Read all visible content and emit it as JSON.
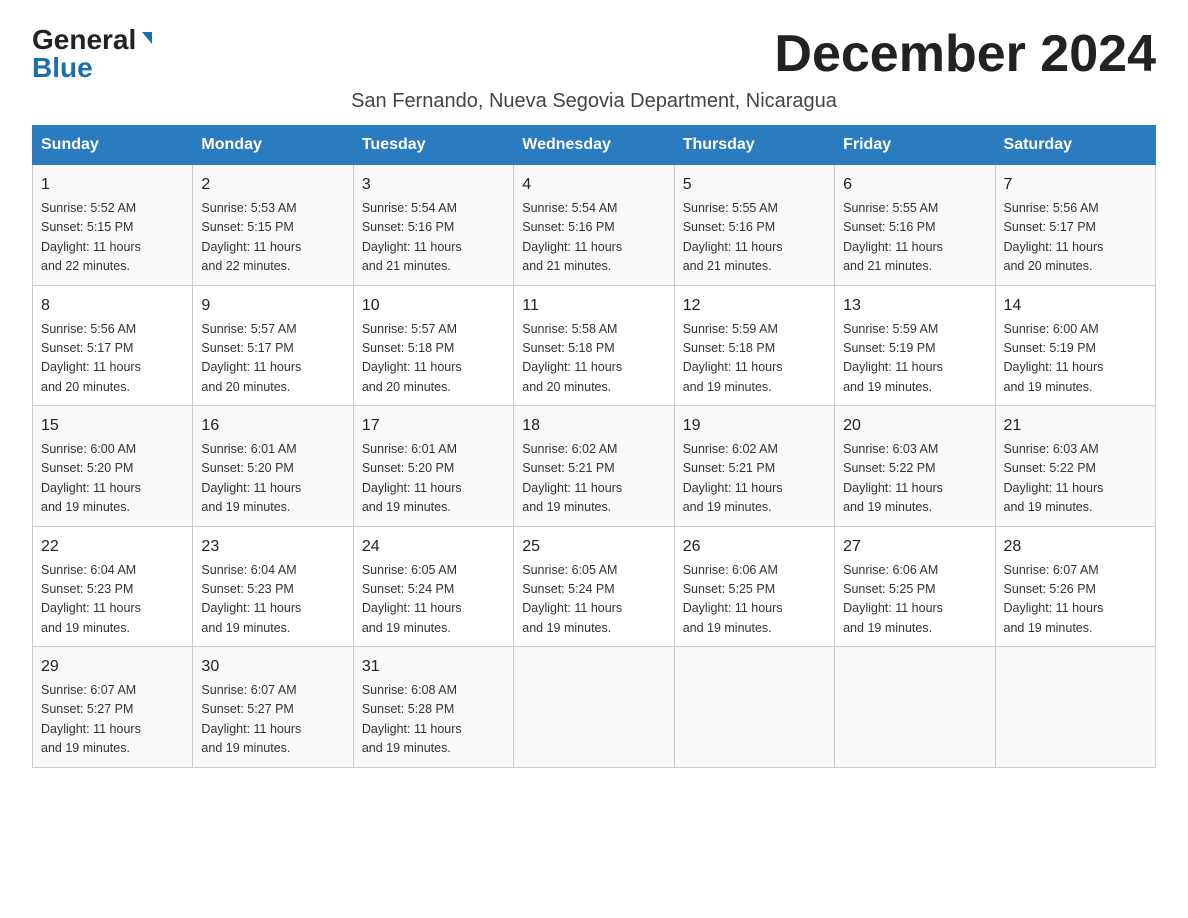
{
  "logo": {
    "general": "General",
    "blue": "Blue"
  },
  "title": "December 2024",
  "subtitle": "San Fernando, Nueva Segovia Department, Nicaragua",
  "days_of_week": [
    "Sunday",
    "Monday",
    "Tuesday",
    "Wednesday",
    "Thursday",
    "Friday",
    "Saturday"
  ],
  "weeks": [
    [
      {
        "day": "1",
        "sunrise": "5:52 AM",
        "sunset": "5:15 PM",
        "daylight": "11 hours and 22 minutes."
      },
      {
        "day": "2",
        "sunrise": "5:53 AM",
        "sunset": "5:15 PM",
        "daylight": "11 hours and 22 minutes."
      },
      {
        "day": "3",
        "sunrise": "5:54 AM",
        "sunset": "5:16 PM",
        "daylight": "11 hours and 21 minutes."
      },
      {
        "day": "4",
        "sunrise": "5:54 AM",
        "sunset": "5:16 PM",
        "daylight": "11 hours and 21 minutes."
      },
      {
        "day": "5",
        "sunrise": "5:55 AM",
        "sunset": "5:16 PM",
        "daylight": "11 hours and 21 minutes."
      },
      {
        "day": "6",
        "sunrise": "5:55 AM",
        "sunset": "5:16 PM",
        "daylight": "11 hours and 21 minutes."
      },
      {
        "day": "7",
        "sunrise": "5:56 AM",
        "sunset": "5:17 PM",
        "daylight": "11 hours and 20 minutes."
      }
    ],
    [
      {
        "day": "8",
        "sunrise": "5:56 AM",
        "sunset": "5:17 PM",
        "daylight": "11 hours and 20 minutes."
      },
      {
        "day": "9",
        "sunrise": "5:57 AM",
        "sunset": "5:17 PM",
        "daylight": "11 hours and 20 minutes."
      },
      {
        "day": "10",
        "sunrise": "5:57 AM",
        "sunset": "5:18 PM",
        "daylight": "11 hours and 20 minutes."
      },
      {
        "day": "11",
        "sunrise": "5:58 AM",
        "sunset": "5:18 PM",
        "daylight": "11 hours and 20 minutes."
      },
      {
        "day": "12",
        "sunrise": "5:59 AM",
        "sunset": "5:18 PM",
        "daylight": "11 hours and 19 minutes."
      },
      {
        "day": "13",
        "sunrise": "5:59 AM",
        "sunset": "5:19 PM",
        "daylight": "11 hours and 19 minutes."
      },
      {
        "day": "14",
        "sunrise": "6:00 AM",
        "sunset": "5:19 PM",
        "daylight": "11 hours and 19 minutes."
      }
    ],
    [
      {
        "day": "15",
        "sunrise": "6:00 AM",
        "sunset": "5:20 PM",
        "daylight": "11 hours and 19 minutes."
      },
      {
        "day": "16",
        "sunrise": "6:01 AM",
        "sunset": "5:20 PM",
        "daylight": "11 hours and 19 minutes."
      },
      {
        "day": "17",
        "sunrise": "6:01 AM",
        "sunset": "5:20 PM",
        "daylight": "11 hours and 19 minutes."
      },
      {
        "day": "18",
        "sunrise": "6:02 AM",
        "sunset": "5:21 PM",
        "daylight": "11 hours and 19 minutes."
      },
      {
        "day": "19",
        "sunrise": "6:02 AM",
        "sunset": "5:21 PM",
        "daylight": "11 hours and 19 minutes."
      },
      {
        "day": "20",
        "sunrise": "6:03 AM",
        "sunset": "5:22 PM",
        "daylight": "11 hours and 19 minutes."
      },
      {
        "day": "21",
        "sunrise": "6:03 AM",
        "sunset": "5:22 PM",
        "daylight": "11 hours and 19 minutes."
      }
    ],
    [
      {
        "day": "22",
        "sunrise": "6:04 AM",
        "sunset": "5:23 PM",
        "daylight": "11 hours and 19 minutes."
      },
      {
        "day": "23",
        "sunrise": "6:04 AM",
        "sunset": "5:23 PM",
        "daylight": "11 hours and 19 minutes."
      },
      {
        "day": "24",
        "sunrise": "6:05 AM",
        "sunset": "5:24 PM",
        "daylight": "11 hours and 19 minutes."
      },
      {
        "day": "25",
        "sunrise": "6:05 AM",
        "sunset": "5:24 PM",
        "daylight": "11 hours and 19 minutes."
      },
      {
        "day": "26",
        "sunrise": "6:06 AM",
        "sunset": "5:25 PM",
        "daylight": "11 hours and 19 minutes."
      },
      {
        "day": "27",
        "sunrise": "6:06 AM",
        "sunset": "5:25 PM",
        "daylight": "11 hours and 19 minutes."
      },
      {
        "day": "28",
        "sunrise": "6:07 AM",
        "sunset": "5:26 PM",
        "daylight": "11 hours and 19 minutes."
      }
    ],
    [
      {
        "day": "29",
        "sunrise": "6:07 AM",
        "sunset": "5:27 PM",
        "daylight": "11 hours and 19 minutes."
      },
      {
        "day": "30",
        "sunrise": "6:07 AM",
        "sunset": "5:27 PM",
        "daylight": "11 hours and 19 minutes."
      },
      {
        "day": "31",
        "sunrise": "6:08 AM",
        "sunset": "5:28 PM",
        "daylight": "11 hours and 19 minutes."
      },
      null,
      null,
      null,
      null
    ]
  ],
  "labels": {
    "sunrise": "Sunrise:",
    "sunset": "Sunset:",
    "daylight": "Daylight:"
  },
  "colors": {
    "header_bg": "#2b7bbf",
    "header_text": "#ffffff",
    "accent_blue": "#1a6faf"
  }
}
